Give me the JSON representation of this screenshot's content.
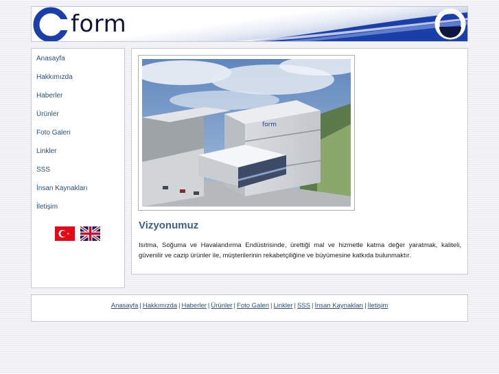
{
  "header": {
    "logo_text": "form",
    "building_sign": "form"
  },
  "sidebar": {
    "items": [
      {
        "label": "Anasayfa"
      },
      {
        "label": "Hakkımızda"
      },
      {
        "label": "Haberler"
      },
      {
        "label": "Ürünler"
      },
      {
        "label": "Foto Galeri"
      },
      {
        "label": "Linkler"
      },
      {
        "label": "SSS"
      },
      {
        "label": "İnsan Kaynakları"
      },
      {
        "label": "İletişim"
      }
    ],
    "flags": [
      {
        "icon": "turkish-flag-icon",
        "color": "#e30a17"
      },
      {
        "icon": "uk-flag-icon",
        "color": "#012169"
      }
    ]
  },
  "main": {
    "heading": "Vizyonumuz",
    "paragraph": "Isıtma, Soğuma ve Havalandırma Endüstrisinde, ürettiği mal ve hizmetle katma değer yaratmak, kaliteli, güvenilir ve cazip ürünler ile, müşterilerinin rekabetçiliğine ve büyümesine katkıda bulunmaktır."
  },
  "footer": {
    "links": [
      {
        "label": "Anasayfa"
      },
      {
        "label": "Hakkımızda"
      },
      {
        "label": "Haberler"
      },
      {
        "label": "Ürünler"
      },
      {
        "label": "Foto Galeri"
      },
      {
        "label": "Linkler"
      },
      {
        "label": "SSS"
      },
      {
        "label": "İnsan Kaynakları"
      },
      {
        "label": "İletişim"
      }
    ],
    "separator": "|"
  },
  "colors": {
    "brand_blue": "#1b3fa8",
    "link": "#2b4f7a",
    "heading": "#3f5f8c"
  }
}
